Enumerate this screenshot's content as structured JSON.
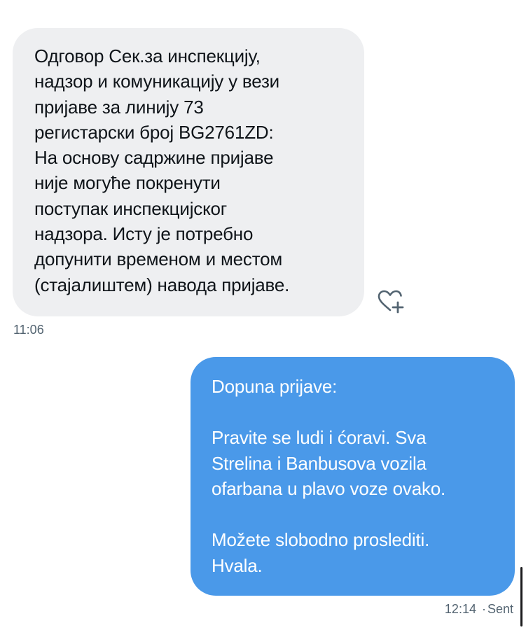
{
  "incoming_message": {
    "lines": [
      "Одговор Сек.за инспекцију,",
      "надзор и комуникацију у вези",
      "пријаве за линију 73",
      "регистарски број BG2761ZD:",
      "На основу садржине пријаве",
      "није могуће покренути",
      "поступак инспекцијског",
      "надзора. Исту је потребно",
      "допунити временом и местом",
      "(стајалиштем) навода пријаве."
    ],
    "time": "11:06",
    "reaction_icon": "heart-plus-icon"
  },
  "outgoing_message": {
    "lines": [
      "Dopuna prijave:",
      "",
      "Pravite se ludi i ćoravi. Sva",
      "Strelina i Banbusova vozila",
      "ofarbana u plavo voze ovako.",
      "",
      "Možete slobodno proslediti.",
      "Hvala."
    ],
    "time": "12:14",
    "separator": "·",
    "status": "Sent"
  },
  "colors": {
    "incoming_bubble": "#eeeff1",
    "outgoing_bubble": "#4a99e9",
    "meta_text": "#536471"
  }
}
